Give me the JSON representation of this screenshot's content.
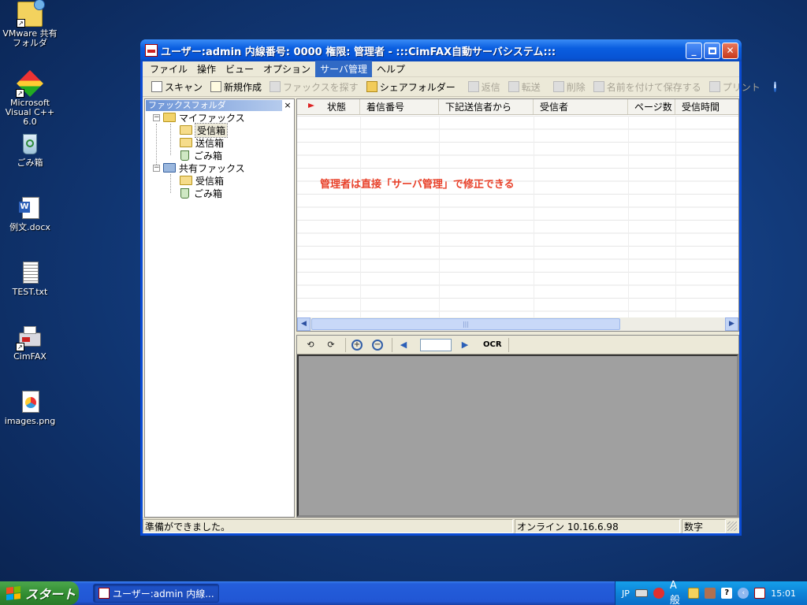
{
  "desktop": {
    "icons": [
      {
        "label": "VMware 共有\nフォルダ",
        "icon": "shared-folder-icon"
      },
      {
        "label": "Microsoft\nVisual C++ 6.0",
        "icon": "visual-cpp-icon"
      },
      {
        "label": "ごみ箱",
        "icon": "recycle-bin-icon"
      },
      {
        "label": "例文.docx",
        "icon": "word-document-icon"
      },
      {
        "label": "TEST.txt",
        "icon": "text-file-icon"
      },
      {
        "label": "CimFAX",
        "icon": "fax-icon"
      },
      {
        "label": "images.png",
        "icon": "image-file-icon"
      }
    ]
  },
  "window": {
    "title": "ユーザー:admin  内線番号: 0000  権限: 管理者 - :::CimFAX自動サーバシステム:::",
    "menu": [
      "ファイル",
      "操作",
      "ビュー",
      "オプション",
      "サーバ管理",
      "ヘルプ"
    ],
    "active_menu": "サーバ管理",
    "toolbar": {
      "scan": "スキャン",
      "new": "新規作成",
      "find_fax": "ファックスを探す",
      "share_folder": "シェアフォルダー",
      "reply": "返信",
      "forward": "転送",
      "delete": "削除",
      "save_as": "名前を付けて保存する",
      "print": "プリント"
    },
    "folder_pane": {
      "title": "ファックスフォルダ",
      "close": "×",
      "my_fax": "マイファックス",
      "inbox": "受信箱",
      "outbox": "送信箱",
      "trash": "ごみ箱",
      "shared_fax": "共有ファックス",
      "shared_inbox": "受信箱",
      "shared_trash": "ごみ箱"
    },
    "list": {
      "columns": [
        "状態",
        "着信番号",
        "下記送信者から",
        "受信者",
        "ページ数",
        "受信時間"
      ]
    },
    "annotation": "管理者は直接「サーバ管理」で修正できる",
    "preview_toolbar": {
      "ocr": "OCR"
    },
    "status": {
      "ready": "準備ができました。",
      "online": "オンライン 10.16.6.98",
      "numlock": "数字"
    }
  },
  "taskbar": {
    "start": "スタート",
    "task_label": "ユーザー:admin  内線...",
    "lang": "JP",
    "ime": "A 般",
    "clock": "15:01"
  },
  "colors": {
    "titlebar": "#0753d4",
    "annotation": "#e8412a",
    "active_menu": "#316ac5"
  }
}
